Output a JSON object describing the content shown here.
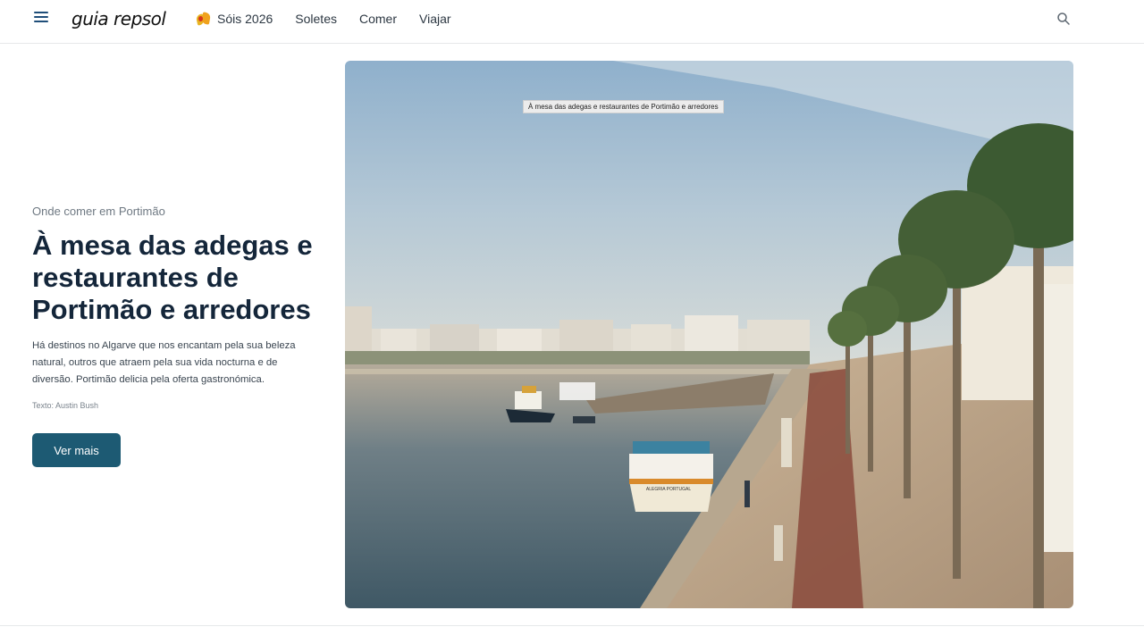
{
  "header": {
    "logo": "guia repsol",
    "nav": [
      {
        "label": "Sóis 2026",
        "icon": "sol-icon"
      },
      {
        "label": "Soletes"
      },
      {
        "label": "Comer"
      },
      {
        "label": "Viajar"
      }
    ],
    "menu_icon": "hamburger-menu-icon",
    "search_icon": "search-icon"
  },
  "article": {
    "eyebrow": "Onde comer em Portimão",
    "title": "À mesa das adegas e restaurantes de Portimão e arredores",
    "description": "Há destinos no Algarve que nos encantam pela sua beleza natural, outros que atraem pela sua vida nocturna e de diversão. Portimão delicia pela oferta gastronómica.",
    "author": "Texto: Austin Bush",
    "cta_label": "Ver mais"
  },
  "hero": {
    "caption": "À mesa das adegas e restaurantes de Portimão e arredores",
    "boat_label": "ALEGRIA PORTUGAL"
  },
  "colors": {
    "primary_button": "#1d5a73",
    "title_text": "#14263a",
    "menu_icon": "#1f4e79"
  }
}
